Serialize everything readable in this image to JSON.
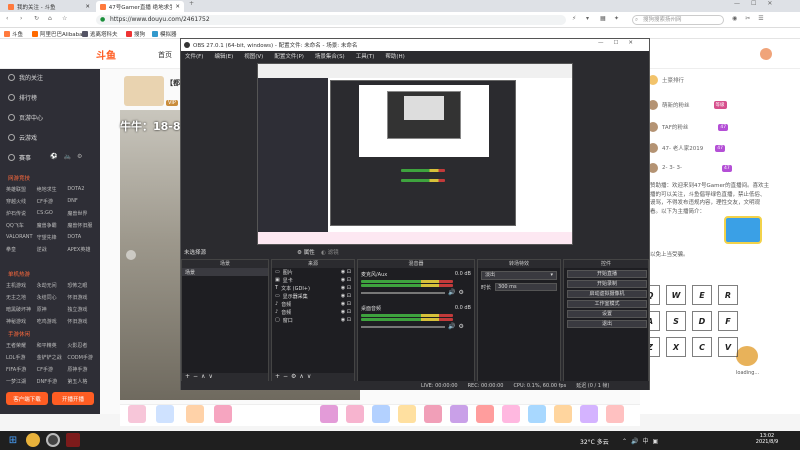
{
  "browser": {
    "tabs": [
      {
        "label": "我的关注 - 斗鱼"
      },
      {
        "label": "47号Gamer直播 绝地求生"
      }
    ],
    "url": "https://www.douyu.com/2461752",
    "search_placeholder": "搜狗搜索扬州网",
    "bookmarks": [
      {
        "label": "斗鱼"
      },
      {
        "label": "阿里巴巴Alibaba"
      },
      {
        "label": "逃离塔科夫"
      },
      {
        "label": "搜狗"
      },
      {
        "label": "模拟器"
      }
    ]
  },
  "douyu": {
    "logo": "斗鱼",
    "nav": [
      "首页"
    ],
    "sidebar": {
      "items": [
        {
          "label": "我的关注"
        },
        {
          "label": "排行榜"
        },
        {
          "label": "页游中心"
        },
        {
          "label": "云游戏"
        },
        {
          "label": "赛事"
        }
      ],
      "sections": [
        {
          "title": "网游竞技",
          "games": [
            "英雄联盟",
            "绝地求生",
            "DOTA2",
            "穿越火线",
            "CF手游",
            "DNF",
            "炉石传说",
            "CS:GO",
            "魔兽世界",
            "QQ飞车",
            "魔兽争霸",
            "魔兽怀旧服",
            "VALORANT",
            "守望先锋",
            "DOTA",
            "拳皇",
            "逆战",
            "APEX英雄"
          ]
        },
        {
          "title": "单机热游",
          "games": [
            "主机游戏",
            "永劫无间",
            "恐怖之眼",
            "无主之地",
            "永结同心",
            "怀旧游戏",
            "暗黑破坏神",
            "原神",
            "独立游戏",
            "神秘游戏",
            "吃鸡游戏",
            "怀旧游戏"
          ]
        },
        {
          "title": "手游休闲",
          "games": [
            "王者荣耀",
            "和平精英",
            "火影忍者",
            "LOL手游",
            "金铲铲之战",
            "CODM手游",
            "FIFA手游",
            "CF手游",
            "原神手游",
            "一梦江湖",
            "DNF手游",
            "第五人格"
          ]
        }
      ],
      "download_button": "客户端下载",
      "open_button": "开播开播"
    },
    "stream_title": "【都",
    "vip_label": "VIP",
    "video_overlay": "牛牛：18-8",
    "right_panel": {
      "rows": [
        {
          "name": "土豪排行",
          "badge": ""
        },
        {
          "name": "萌新的粉丝",
          "badge": "等级"
        },
        {
          "name": "TAF的粉丝",
          "badge": "47"
        },
        {
          "name": "47- 老人家2019",
          "badge": "47"
        },
        {
          "name": "2- 3- 3-",
          "badge": "47"
        }
      ],
      "chat": "赞助播：欢迎来到47号Gamer的直播间。喜欢主播的可以关注，斗鱼倡导绿色直播，禁止低俗、谩骂，不得发布违规内容，理性交友，文明观看。以下为主播简介：",
      "chat_tail": "以免上当受骗。",
      "loading": "loading..."
    },
    "keyboard": [
      "TAB",
      "Q",
      "W",
      "E",
      "R",
      "SHIFT",
      "A",
      "S",
      "D",
      "F",
      "CTRL",
      "Z",
      "X",
      "C",
      "V"
    ]
  },
  "obs": {
    "title": "OBS 27.0.1 (64-bit, windows) - 配置文件: 未命名 - 场景: 未命名",
    "menu": [
      "文件(F)",
      "编辑(E)",
      "视图(V)",
      "配置文件(P)",
      "场景集合(S)",
      "工具(T)",
      "帮助(H)"
    ],
    "bar_label": "未选择源",
    "bar_buttons": [
      "属性",
      "滤镜"
    ],
    "panels": {
      "scenes": "场景",
      "sources": "来源",
      "mixer": "混音器",
      "transitions": "转场特效",
      "controls": "控件"
    },
    "scene_item": "场景",
    "sources": [
      "图片",
      "显卡",
      "文本 (GDI+)",
      "显示器采集",
      "音频",
      "音频",
      "窗口"
    ],
    "mixer": [
      {
        "name": "麦克风/Aux",
        "db": "0.0 dB"
      },
      {
        "name": "桌面音频",
        "db": "0.0 dB"
      }
    ],
    "transition": {
      "type": "淡出",
      "duration_label": "时长",
      "duration": "300 ms"
    },
    "controls": [
      "开始直播",
      "开始录制",
      "启动虚拟摄像机",
      "工作室模式",
      "设置",
      "退出"
    ],
    "status": {
      "live": "LIVE: 00:00:00",
      "rec": "REC: 00:00:00",
      "cpu": "CPU: 0.1%, 60.00 fps",
      "dropped": "延迟 (0 / 1 帧)"
    }
  },
  "taskbar": {
    "weather": "32°C 多云",
    "time": "13:02",
    "date": "2021/8/9"
  }
}
